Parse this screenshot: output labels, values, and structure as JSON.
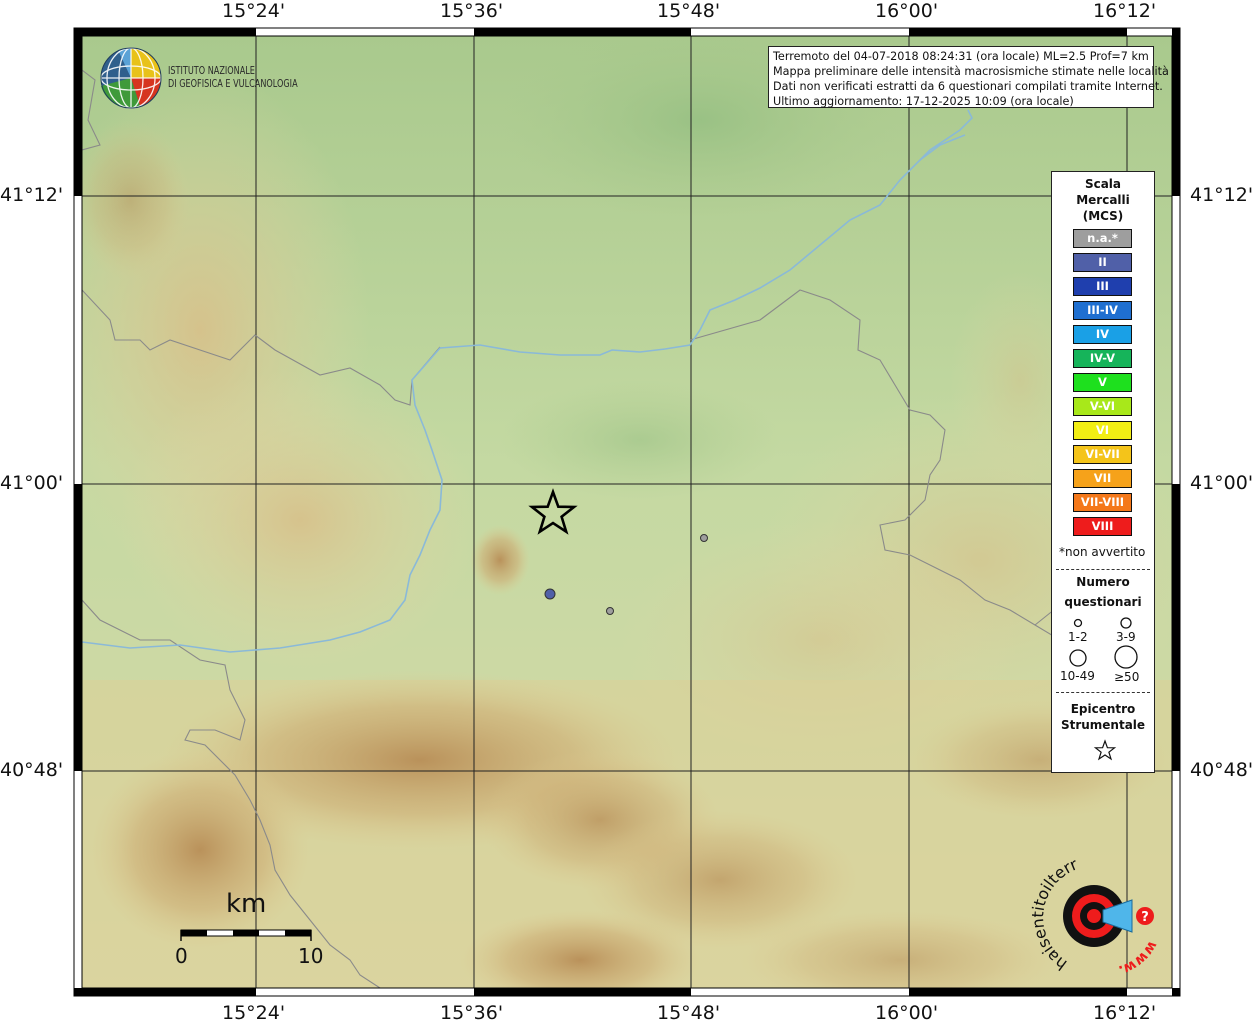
{
  "graticule": {
    "lon_labels": [
      "15°24'",
      "15°36'",
      "15°48'",
      "16°00'",
      "16°12'"
    ],
    "lat_labels": [
      "41°12'",
      "41°00'",
      "40°48'"
    ]
  },
  "event_info": {
    "line1": "Terremoto del 04-07-2018 08:24:31 (ora locale) ML=2.5 Prof=7 km",
    "line2": "Mappa preliminare delle intensità macrosismiche stimate nelle località",
    "line3": "Dati non verificati estratti da 6 questionari compilati tramite Internet.",
    "line4": "Ultimo aggiornamento: 17-12-2025 10:09 (ora locale)"
  },
  "institute": {
    "line1": "ISTITUTO NAZIONALE",
    "line2": "DI GEOFISICA E VULCANOLOGIA"
  },
  "legend": {
    "title_lines": [
      "Scala",
      "Mercalli",
      "(MCS)"
    ],
    "intensity_classes": [
      {
        "label": "n.a.*",
        "color": "#9e9e9e"
      },
      {
        "label": "II",
        "color": "#5060a8"
      },
      {
        "label": "III",
        "color": "#1f3fae"
      },
      {
        "label": "III-IV",
        "color": "#1f6fd0"
      },
      {
        "label": "IV",
        "color": "#1aa0e6"
      },
      {
        "label": "IV-V",
        "color": "#16b45a"
      },
      {
        "label": "V",
        "color": "#1ee01e"
      },
      {
        "label": "V-VI",
        "color": "#a8e81a"
      },
      {
        "label": "VI",
        "color": "#f2ee14"
      },
      {
        "label": "VI-VII",
        "color": "#f4c41a"
      },
      {
        "label": "VII",
        "color": "#f6a21a"
      },
      {
        "label": "VII-VIII",
        "color": "#f4781a"
      },
      {
        "label": "VIII",
        "color": "#ee1c1c"
      }
    ],
    "note": "*non avvertito",
    "count_title_lines": [
      "Numero",
      "questionari"
    ],
    "count_classes": [
      "1-2",
      "3-9",
      "10-49",
      "≥50"
    ],
    "epicenter_title_lines": [
      "Epicentro",
      "Strumentale"
    ]
  },
  "scale_bar": {
    "unit": "km",
    "min_label": "0",
    "max_label": "10"
  },
  "questionnaire_points": [
    {
      "intensity": "II",
      "count_class": "3-9"
    },
    {
      "intensity": "n.a.*",
      "count_class": "1-2"
    },
    {
      "intensity": "n.a.*",
      "count_class": "1-2"
    }
  ],
  "site_logo": {
    "text_left": "haisentitoilterremoto",
    "text_tld": ".it",
    "text_www": "www.",
    "symbol": "?"
  },
  "colors": {
    "river": "#8ab9d8",
    "border": "#8a8a8a",
    "frame": "#000000"
  }
}
